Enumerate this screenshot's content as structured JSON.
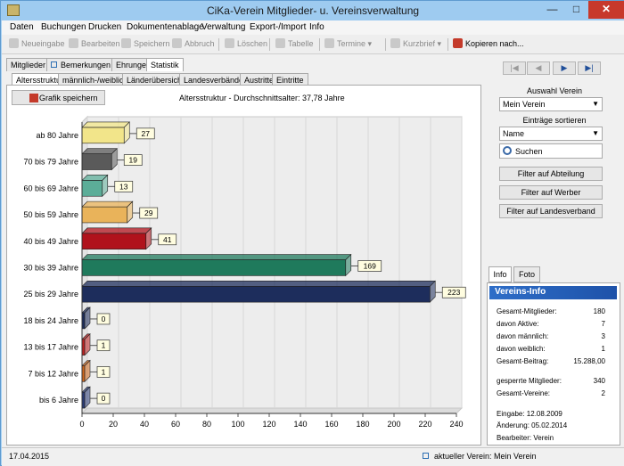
{
  "window": {
    "title": "CiKa-Verein   Mitglieder- u. Vereinsverwaltung",
    "minimize": "—",
    "maximize": "□",
    "close": "✕"
  },
  "menu": [
    "Daten",
    "Buchungen",
    "Drucken",
    "Dokumentenablage",
    "Verwaltung",
    "Export-/Import",
    "Info"
  ],
  "toolbar": {
    "neueingabe": "Neueingabe",
    "bearbeiten": "Bearbeiten",
    "speichern": "Speichern",
    "abbruch": "Abbruch",
    "loeschen": "Löschen",
    "tabelle": "Tabelle",
    "termine": "Termine",
    "kurzbrief": "Kurzbrief",
    "kopieren": "Kopieren nach..."
  },
  "tabs_main": [
    "Mitglieder",
    "Bemerkungen",
    "Ehrungen",
    "Statistik"
  ],
  "tabs_sub": [
    "Altersstruktur",
    "männlich-/weiblich",
    "Länderübersicht",
    "Landesverbände",
    "Austritte",
    "Eintritte"
  ],
  "stats": {
    "save_label": "Grafik speichern",
    "chart_title": "Altersstruktur - Durchschnittsalter: 37,78 Jahre"
  },
  "chart_data": {
    "type": "bar",
    "orientation": "horizontal",
    "title": "Altersstruktur - Durchschnittsalter: 37,78 Jahre",
    "categories": [
      "ab 80 Jahre",
      "70 bis 79 Jahre",
      "60 bis 69 Jahre",
      "50 bis 59 Jahre",
      "40 bis 49 Jahre",
      "30 bis 39 Jahre",
      "25 bis 29 Jahre",
      "18 bis 24 Jahre",
      "13 bis 17 Jahre",
      "7 bis 12 Jahre",
      "bis 6 Jahre"
    ],
    "values": [
      27,
      19,
      13,
      29,
      41,
      169,
      223,
      0,
      1,
      1,
      0
    ],
    "colors": [
      "#f2e58a",
      "#5a5a5a",
      "#5cad98",
      "#e9b35a",
      "#b0121c",
      "#1f7a5c",
      "#1d2d5c",
      "#1d2d5c",
      "#c22222",
      "#d2691e",
      "#2a3c78"
    ],
    "xlim": [
      0,
      240
    ],
    "xticks": [
      0,
      20,
      40,
      60,
      80,
      100,
      120,
      140,
      160,
      180,
      200,
      220,
      240
    ],
    "xtick_labels": [
      "0",
      "20",
      "40",
      "60",
      "80",
      "100",
      "120",
      "140",
      "160",
      "180",
      "200",
      "220",
      "240"
    ],
    "grid": true
  },
  "right": {
    "auswahl_label": "Auswahl Verein",
    "verein": "Mein Verein",
    "sortieren_label": "Einträge sortieren",
    "sort": "Name",
    "search_placeholder": "Suchen",
    "filter_abteilung": "Filter auf Abteilung",
    "filter_werber": "Filter auf Werber",
    "filter_landesverband": "Filter auf Landesverband",
    "nav": [
      "|◀",
      "◀",
      "▶",
      "▶|"
    ],
    "info_tabs": [
      "Info",
      "Foto"
    ]
  },
  "info": {
    "title": "Vereins-Info",
    "rows": [
      {
        "label": "Gesamt-Mitglieder:",
        "value": "180"
      },
      {
        "label": "davon Aktive:",
        "value": "7"
      },
      {
        "label": "davon männlich:",
        "value": "3"
      },
      {
        "label": "davon weiblich:",
        "value": "1"
      },
      {
        "label": "Gesamt-Beitrag:",
        "value": "15.288,00"
      },
      {
        "label": "gesperrte Mitglieder:",
        "value": "340"
      },
      {
        "label": "Gesamt-Vereine:",
        "value": "2"
      }
    ],
    "eingabe": "Eingabe:       12.08.2009",
    "aenderung": "Änderung:    05.02.2014",
    "bearbeiter": "Bearbeiter: Verein"
  },
  "status": {
    "date": "17.04.2015",
    "verein": "aktueller Verein: Mein Verein"
  }
}
